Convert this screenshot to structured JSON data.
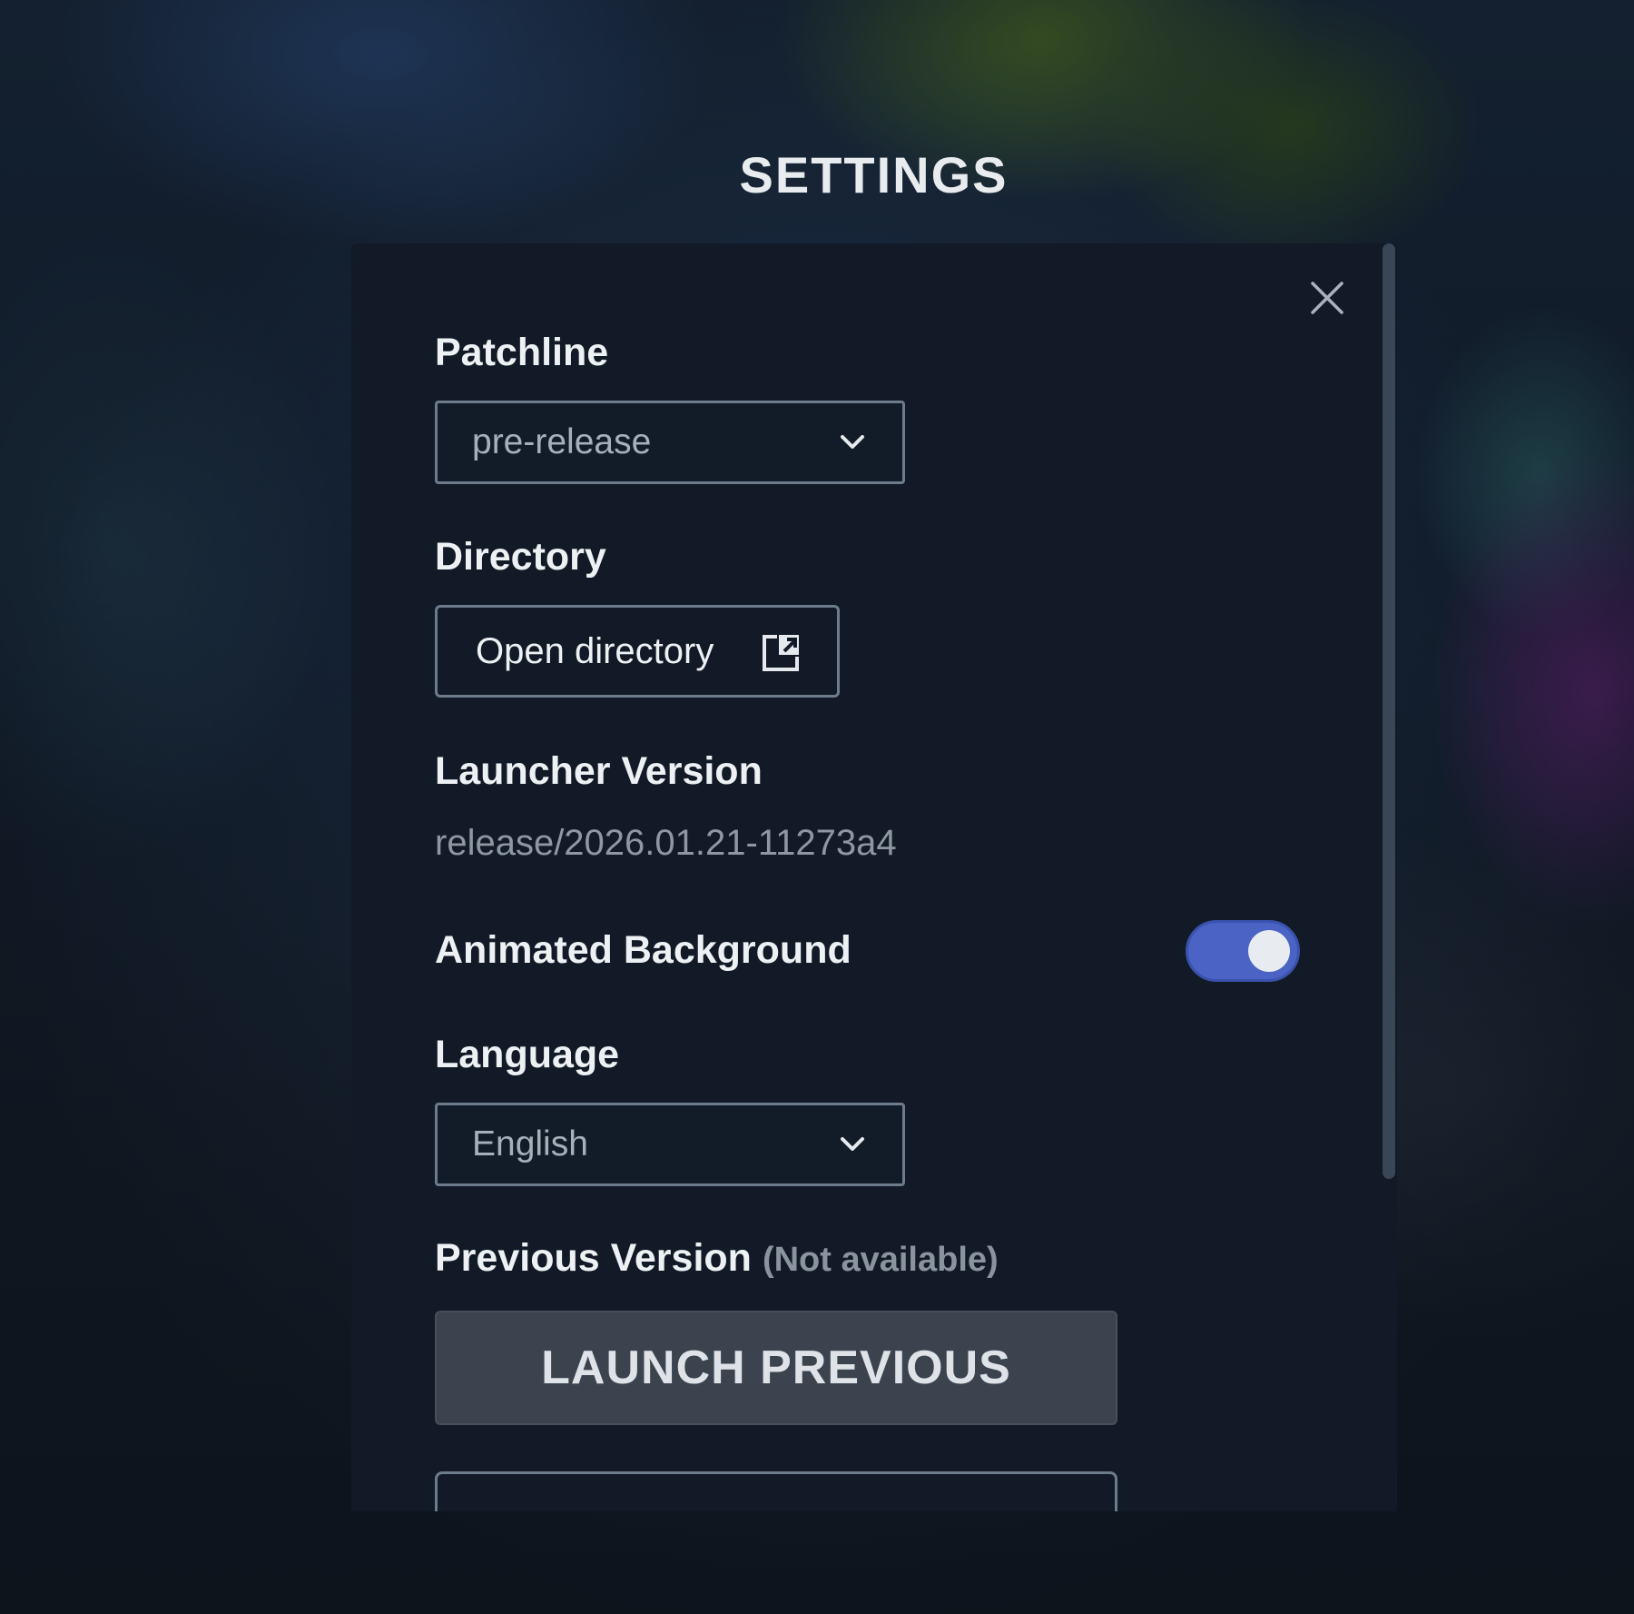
{
  "page": {
    "title": "SETTINGS"
  },
  "settings": {
    "patchline": {
      "label": "Patchline",
      "selected": "pre-release"
    },
    "directory": {
      "label": "Directory",
      "button_label": "Open directory"
    },
    "launcher_version": {
      "label": "Launcher Version",
      "value": "release/2026.01.21-11273a4"
    },
    "animated_background": {
      "label": "Animated Background",
      "enabled": true
    },
    "language": {
      "label": "Language",
      "selected": "English"
    },
    "previous_version": {
      "label": "Previous Version",
      "status": "(Not available)",
      "button_label": "LAUNCH PREVIOUS"
    }
  },
  "icons": {
    "close": "close-icon",
    "dropdown": "chevron-down-icon",
    "external": "external-link-icon"
  },
  "colors": {
    "panel_bg": "#111a26",
    "toggle_on": "#4a63c4",
    "launch_button_bg": "#3a434e",
    "border": "#6c7c8d"
  }
}
